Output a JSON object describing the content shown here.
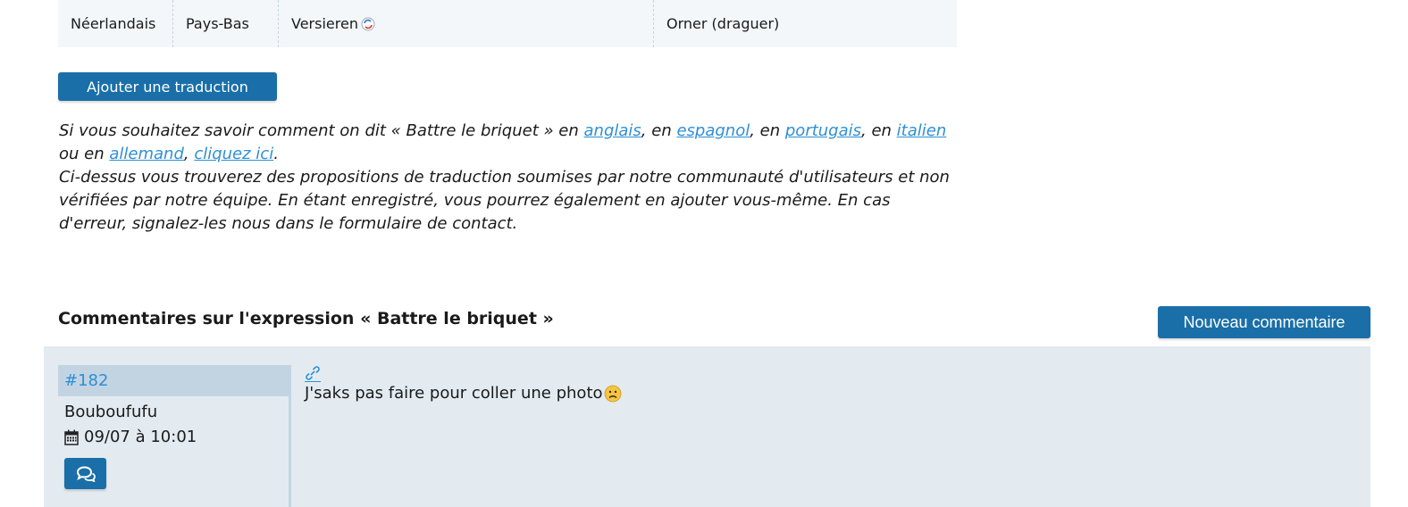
{
  "translation_row": {
    "language": "Néerlandais",
    "country": "Pays-Bas",
    "translation": "Versieren",
    "meaning": "Orner (draguer)"
  },
  "add_translation_label": "Ajouter une traduction",
  "info": {
    "part1": "Si vous souhaitez savoir comment on dit « Battre le briquet » en ",
    "link_english": "anglais",
    "sep1": ", en ",
    "link_spanish": "espagnol",
    "sep2": ", en ",
    "link_portuguese": "portugais",
    "sep3": ", en ",
    "link_italian": "italien",
    "sep4": " ou en ",
    "link_german": "allemand",
    "sep5": ", ",
    "link_click": "cliquez ici",
    "end": ".",
    "paragraph2": "Ci-dessus vous trouverez des propositions de traduction soumises par notre communauté d'utilisateurs et non vérifiées par notre équipe. En étant enregistré, vous pourrez également en ajouter vous-même. En cas d'erreur, signalez-les nous dans le formulaire de contact."
  },
  "comments": {
    "title": "Commentaires sur l'expression « Battre le briquet »",
    "new_comment_label": "Nouveau commentaire",
    "items": [
      {
        "id": "#182",
        "author": "Bouboufufu",
        "date": "09/07 à 10:01",
        "text": "J'saks pas faire pour coller une photo"
      }
    ]
  },
  "icons": {
    "translation_swap": "swap-icon",
    "date": "calendar-icon",
    "reply": "chat-bubbles-icon",
    "permalink": "link-icon",
    "emoji": "sad-face-emoji"
  },
  "colors": {
    "accent": "#1a6fa8",
    "link": "#2f8fd6",
    "comment_bg": "#e3ebf1",
    "comment_header_bg": "#c2d4e2"
  }
}
